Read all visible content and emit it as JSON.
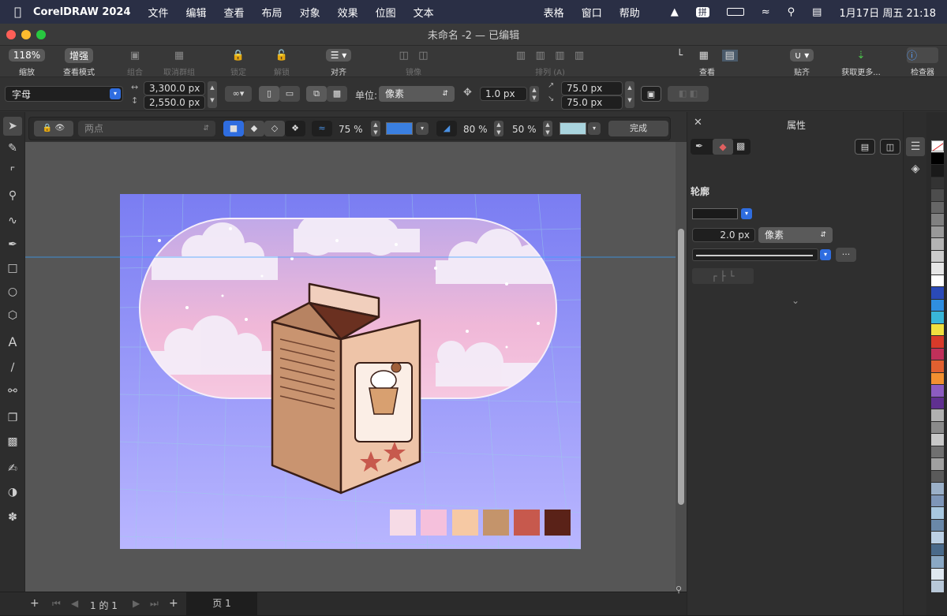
{
  "menubar": {
    "apple": "",
    "app": "CorelDRAW 2024",
    "items": [
      "文件",
      "编辑",
      "查看",
      "布局",
      "对象",
      "效果",
      "位图",
      "文本"
    ],
    "right_items": [
      "表格",
      "窗口",
      "帮助"
    ],
    "ime": "拼",
    "clock": "1月17日 周五  21:18"
  },
  "window": {
    "title": "未命名 -2 — 已编辑"
  },
  "toolbar": {
    "zoom_value": "118%",
    "zoom_label": "缩放",
    "view_mode_value": "增强",
    "view_mode_label": "查看模式",
    "group": "组合",
    "ungroup": "取消群组",
    "lock": "锁定",
    "unlock": "解锁",
    "align": "对齐",
    "mirror": "镜像",
    "arrange": "排列 (A)",
    "view": "查看",
    "snap": "贴齐",
    "get_more": "获取更多...",
    "inspector": "检查器"
  },
  "propbar": {
    "font_select": "字母",
    "width": "3,300.0 px",
    "height": "2,550.0 px",
    "units_label": "单位:",
    "units_value": "像素",
    "nudge": "1.0 px",
    "dup_x": "75.0 px",
    "dup_y": "75.0 px"
  },
  "interactive_bar": {
    "preset": "两点",
    "opacity": "75 %",
    "fill_color": "#3a7fe0",
    "depth": "80 %",
    "percent2": "50 %",
    "shadow_color": "#a9d4de",
    "done": "完成"
  },
  "right_panel": {
    "title": "属性",
    "section": "轮廓",
    "outline_width": "2.0 px",
    "outline_unit": "像素",
    "more": "···"
  },
  "pagebar": {
    "page_count": "1 的 1",
    "page_tab": "页 1"
  },
  "artwork_swatches": [
    "#f6dbe6",
    "#f5c0dc",
    "#f6c9a4",
    "#c4946b",
    "#c7594d",
    "#5a2218"
  ],
  "color_palette": [
    "#ffffff",
    "#000000",
    "#1a1a1a",
    "#333333",
    "#4d4d4d",
    "#666666",
    "#808080",
    "#999999",
    "#b3b3b3",
    "#cccccc",
    "#e6e6e6",
    "#ffffff",
    "#2a4ab8",
    "#2f8ee0",
    "#39b6d8",
    "#f0e040",
    "#d83a2a",
    "#c0305a",
    "#e06030",
    "#f29030",
    "#8c5cc0",
    "#603090",
    "#b0b0b0",
    "#8a8a8a",
    "#c8c8c8",
    "#707070",
    "#a0a0a0",
    "#5a5a5a",
    "#9bb0c8",
    "#7e96b8",
    "#a8c8e0",
    "#6a88a8",
    "#bcd0e4",
    "#4a6a8a",
    "#8aa8c4",
    "#dfe8f0",
    "#b8c8d8"
  ]
}
